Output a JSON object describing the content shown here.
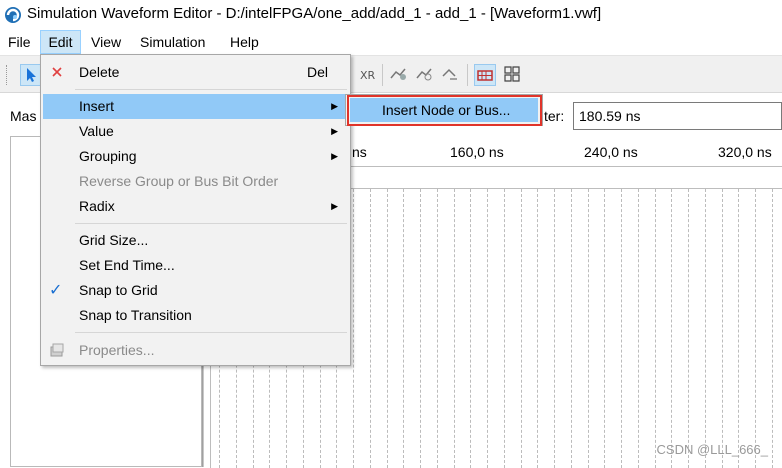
{
  "window": {
    "title": "Simulation Waveform Editor - D:/intelFPGA/one_add/add_1 - add_1 - [Waveform1.vwf]",
    "app_icon": "quartus-app-icon"
  },
  "menubar": {
    "items": [
      {
        "label": "File"
      },
      {
        "label": "Edit"
      },
      {
        "label": "View"
      },
      {
        "label": "Simulation"
      },
      {
        "label": "Help"
      }
    ]
  },
  "edit_menu": {
    "items": [
      {
        "label": "Delete",
        "shortcut": "Del",
        "icon": "delete-x-icon",
        "enabled": true
      },
      {
        "label": "Insert",
        "submenu": true,
        "enabled": true,
        "highlighted": true
      },
      {
        "label": "Value",
        "submenu": true,
        "enabled": true
      },
      {
        "label": "Grouping",
        "submenu": true,
        "enabled": true
      },
      {
        "label": "Reverse Group or Bus Bit Order",
        "enabled": false
      },
      {
        "label": "Radix",
        "submenu": true,
        "enabled": true
      },
      {
        "label": "Grid Size...",
        "enabled": true
      },
      {
        "label": "Set End Time...",
        "enabled": true
      },
      {
        "label": "Snap to Grid",
        "checked": true,
        "enabled": true
      },
      {
        "label": "Snap to Transition",
        "enabled": true
      },
      {
        "label": "Properties...",
        "icon": "properties-icon",
        "enabled": false
      }
    ],
    "arrow_glyph": "▶",
    "check_glyph": "✓"
  },
  "insert_submenu": {
    "items": [
      {
        "label": "Insert Node or Bus..."
      }
    ]
  },
  "left_pane": {
    "label_partial": "Mas"
  },
  "pointer": {
    "label_partial": "ter:",
    "value": "180.59 ns"
  },
  "ruler": {
    "ticks": [
      {
        "label": "ns"
      },
      {
        "label": "160,0 ns"
      },
      {
        "label": "240,0 ns"
      },
      {
        "label": "320,0 ns"
      }
    ]
  },
  "watermark": "CSDN @LLL_666_",
  "colors": {
    "menu_highlight": "#91c9f7",
    "callout_red": "#e0342a",
    "delete_icon_red": "#e04040",
    "check_blue": "#1a6fd1"
  }
}
